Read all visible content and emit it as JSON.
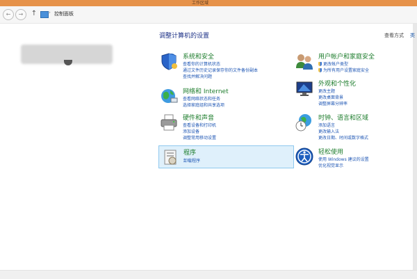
{
  "window": {
    "title": "工作区域"
  },
  "addressbar": {
    "back_icon": "arrow-left-icon",
    "forward_icon": "arrow-right-icon",
    "up_icon": "arrow-up-icon",
    "crumb": "控制面板",
    "sep": "›"
  },
  "main": {
    "title": "调整计算机的设置",
    "view_by": "查看方式",
    "view_value": "类"
  },
  "categories": [
    {
      "title": "系统和安全",
      "icon": "shield-icon",
      "links": [
        "查看你的计算机状态",
        "通过文件历史记录保存你的文件备份副本",
        "查找并解决问题"
      ]
    },
    {
      "title": "网络和 Internet",
      "icon": "network-globe-icon",
      "links": [
        "查看网络状态和任务",
        "选择家庭组和共享选项"
      ]
    },
    {
      "title": "硬件和声音",
      "icon": "printer-icon",
      "links": [
        "查看设备和打印机",
        "添加设备",
        "调整常用移动设置"
      ]
    },
    {
      "title": "程序",
      "icon": "programs-icon",
      "links": [
        "卸载程序"
      ]
    },
    {
      "title": "用户帐户和家庭安全",
      "icon": "users-icon",
      "links": [
        "更改帐户类型",
        "为所有用户设置家庭安全"
      ]
    },
    {
      "title": "外观和个性化",
      "icon": "monitor-icon",
      "links": [
        "更改主题",
        "更改桌面背景",
        "调整屏幕分辨率"
      ]
    },
    {
      "title": "时钟、语言和区域",
      "icon": "clock-globe-icon",
      "links": [
        "添加语言",
        "更改输入法",
        "更改日期、时间或数字格式"
      ]
    },
    {
      "title": "轻松使用",
      "icon": "ease-of-access-icon",
      "links": [
        "使用 Windows 建议的设置",
        "优化视觉显示"
      ]
    }
  ]
}
